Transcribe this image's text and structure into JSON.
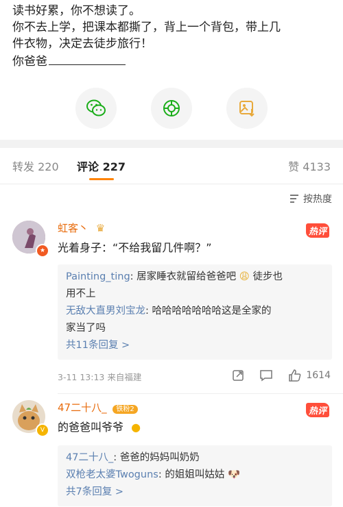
{
  "post": {
    "line1": "读书好累，你不想读了。",
    "line2": "你不去上学，把课本都撕了，背上一个背包，带上几",
    "line3": "件衣物，决定去徒步旅行！",
    "line4": "你爸爸"
  },
  "share": {
    "items": [
      {
        "icon": "wechat-icon",
        "color": "#1aad19"
      },
      {
        "icon": "moments-icon",
        "color": "#1aad19"
      },
      {
        "icon": "save-image-icon",
        "color": "#e8a93b"
      }
    ]
  },
  "tabs": {
    "repost_label": "转发",
    "repost_count": "220",
    "comment_label": "评论",
    "comment_count": "227",
    "like_label": "赞",
    "like_count": "4133"
  },
  "sort": {
    "label": "按热度"
  },
  "comments": [
    {
      "username": "虹客丶",
      "hot_label": "热评",
      "text": "光着身子：“不给我留几件啊？”",
      "replies": [
        {
          "name": "Painting_ting",
          "text_a": "居家睡衣就留给爸爸吧",
          "text_b": "徒步也",
          "text_c": "用不上"
        },
        {
          "name": "无敌大直男刘宝龙",
          "text_a": "哈哈哈哈哈哈哈这是全家的",
          "text_c": "家当了吗"
        }
      ],
      "more_replies": "共11条回复 >",
      "meta": "3-11 13:13  来自福建",
      "like_count": "1614"
    },
    {
      "username": "47二十八_",
      "fan_badge": "铁粉2",
      "hot_label": "热评",
      "text": "的爸爸叫爷爷",
      "replies": [
        {
          "name": "47二十八_",
          "text_a": "爸爸的妈妈叫奶奶"
        },
        {
          "name": "双枪老太婆Twoguns",
          "text_a": "的姐姐叫姑姑"
        }
      ],
      "more_replies": "共7条回复 >"
    }
  ],
  "colors": {
    "accent": "#ff8200",
    "username": "#e86b0c",
    "reply_name": "#5a7fb0",
    "hot_tag": "#ff4e3a"
  }
}
